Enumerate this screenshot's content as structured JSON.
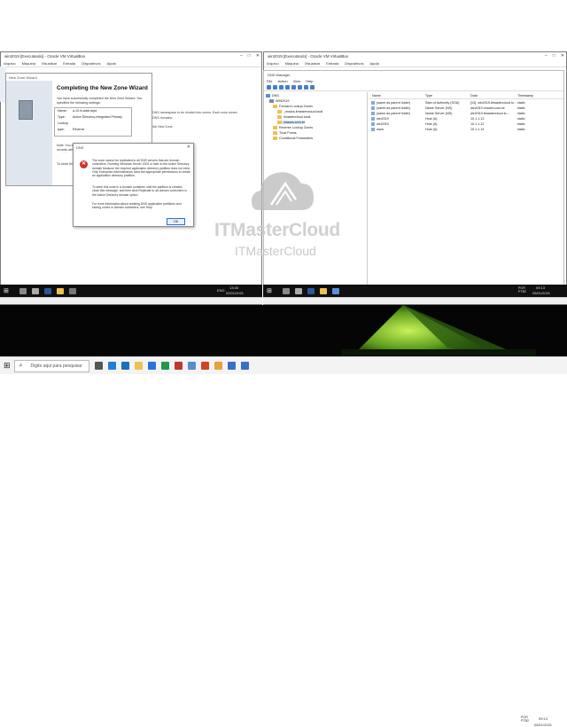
{
  "left_vm": {
    "title": "win2019 [Executando] - Oracle VM VirtualBox",
    "menu": [
      "Arquivo",
      "Máquina",
      "Visualizar",
      "Entrada",
      "Dispositivos",
      "Ajuda"
    ],
    "wizard": {
      "window_title": "New Zone Wizard",
      "heading": "Completing the New Zone Wizard",
      "intro": "You have successfully completed the New Zone Wizard. You specified the following settings:",
      "summary": [
        {
          "k": "Name:",
          "v": "a.10.in-addr.arpa"
        },
        {
          "k": "Type:",
          "v": "Active Directory-Integrated Primary"
        },
        {
          "k": "Lookup type:",
          "v": "Reverse"
        }
      ],
      "note": "Note: You should now add records to the zone or ensure that records are updated dynamically. You can then verify name resolution using nslookup.",
      "close_text": "To close this wizard and create the new zone, click Finish.",
      "bg_text_1": "DNS namespace to be divided into zones. Each zone stores",
      "bg_text_2": "DNS domains.",
      "bg_text_3": "lick New Zone."
    },
    "error_dialog": {
      "title": "DNS",
      "message_1": "The zone cannot be replicated to all DNS servers that are domain controllers. Running Windows Server 2003 or later in the Active Directory domain because the required application directory partition does not exist. Only Enterprise Administrators have the appropriate permissions to create an application directory partition.",
      "message_2": "To store this zone in a domain container until the partition is created, close this message, and then click Replicate to all domain controllers in the Active Directory domain option.",
      "message_3": "For more information about creating DNS application partitions and storing zones in domain containers, see Help.",
      "ok_label": "OK"
    },
    "taskbar": {
      "time": "13:45",
      "date": "02/01/2021",
      "lang": "ENG"
    }
  },
  "right_vm": {
    "title": "win2019 [Executando] - Oracle VM VirtualBox",
    "menu": [
      "Arquivo",
      "Máquina",
      "Visualizar",
      "Entrada",
      "Dispositivos",
      "Ajuda"
    ],
    "dns": {
      "title": "DNS Manager",
      "menu": [
        "File",
        "Action",
        "View",
        "Help"
      ],
      "tree": [
        {
          "label": "DNS",
          "indent": 0
        },
        {
          "label": "WIN2019",
          "indent": 1
        },
        {
          "label": "Forward Lookup Zones",
          "indent": 2
        },
        {
          "label": "_msdcs.itmastercloud.local",
          "indent": 3
        },
        {
          "label": "ilmastercloud.local",
          "indent": 3
        },
        {
          "label": "chaves.com.br",
          "indent": 3
        },
        {
          "label": "Reverse Lookup Zones",
          "indent": 2
        },
        {
          "label": "Trust Points",
          "indent": 2
        },
        {
          "label": "Conditional Forwarders",
          "indent": 2
        }
      ],
      "columns": [
        "Name",
        "Type",
        "Data",
        "Timestamp"
      ],
      "rows": [
        [
          "(same as parent folder)",
          "Start of Authority (SOA)",
          "[13], win2019.itmastercloud.lo...",
          "static"
        ],
        [
          "(same as parent folder)",
          "Name Server (NS)",
          "win2019.chaves.com.br.",
          "static"
        ],
        [
          "(same as parent folder)",
          "Name Server (NS)",
          "win2019.itmastercloud.lo...",
          "static"
        ],
        [
          "win2019",
          "Host (A)",
          "10.1.1.13",
          "static"
        ],
        [
          "win2019",
          "Host (A)",
          "10.1.1.12",
          "static"
        ],
        [
          "www",
          "Host (A)",
          "10.1.1.14",
          "static"
        ]
      ]
    },
    "taskbar": {
      "time": "09:13",
      "date": "05/01/2021",
      "lang": "POR PTB2"
    }
  },
  "watermark": {
    "line1": "ITMasterCloud",
    "line2": "ITMasterCloud"
  },
  "host_taskbar": {
    "search_placeholder": "Digite aqui para pesquisar",
    "lang": "POR PTB2",
    "time": "09:13",
    "date": "05/01/2021"
  }
}
